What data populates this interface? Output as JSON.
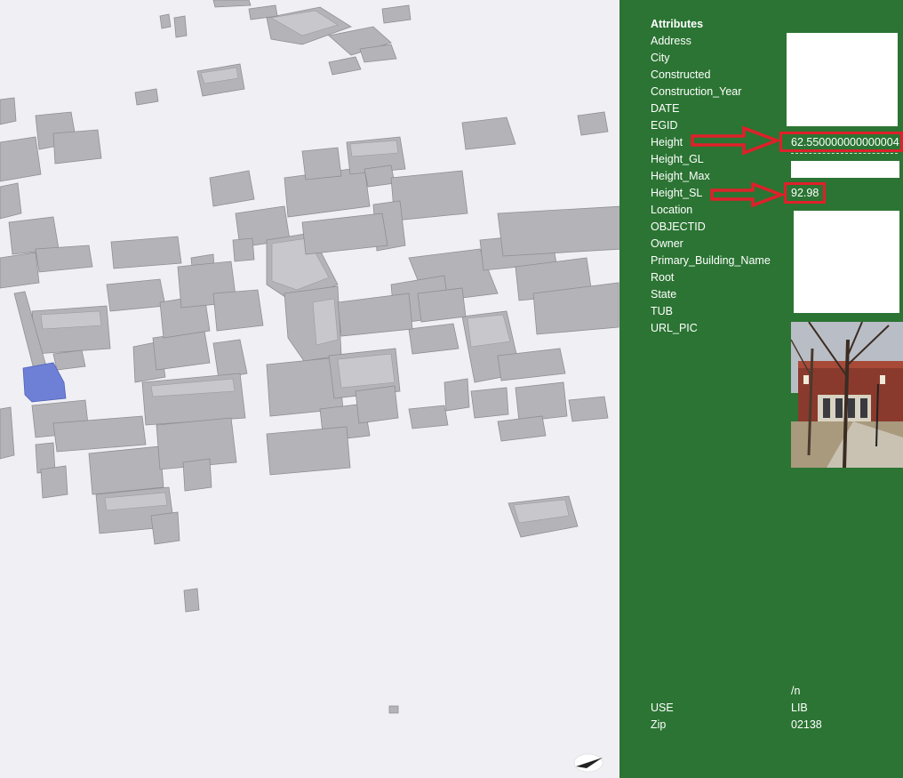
{
  "panel": {
    "title": "Attributes",
    "attributes": [
      {
        "label": "Address"
      },
      {
        "label": "City"
      },
      {
        "label": "Constructed"
      },
      {
        "label": "Construction_Year"
      },
      {
        "label": "DATE"
      },
      {
        "label": "EGID"
      },
      {
        "label": "Height",
        "value": "62.550000000000004"
      },
      {
        "label": "Height_GL"
      },
      {
        "label": "Height_Max"
      },
      {
        "label": "Height_SL",
        "value": "92.98"
      },
      {
        "label": "Location"
      },
      {
        "label": "OBJECTID"
      },
      {
        "label": "Owner"
      },
      {
        "label": "Primary_Building_Name"
      },
      {
        "label": "Root"
      },
      {
        "label": "State"
      },
      {
        "label": "TUB"
      },
      {
        "label": "URL_PIC"
      }
    ],
    "extra_value": "/n",
    "footer_rows": [
      {
        "label": "USE",
        "value": "LIB"
      },
      {
        "label": "Zip",
        "value": "02138"
      }
    ]
  },
  "colors": {
    "panel_bg": "#2b7433",
    "highlight": "#e0202a",
    "selected_building": "#6e7fd6",
    "scene_bg": "#f0f0f4"
  },
  "icons": {
    "compass": "north-arrow-icon",
    "annotation": "red-arrow-icon"
  }
}
